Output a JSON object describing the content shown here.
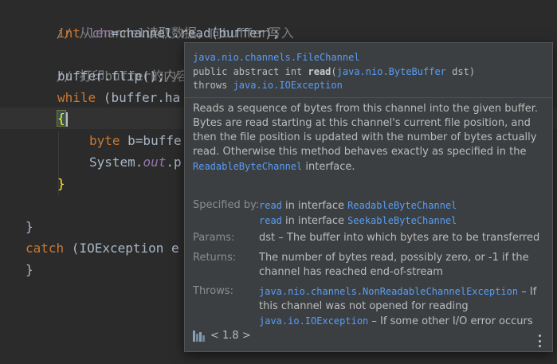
{
  "editor": {
    "line1": {
      "comment": "// 从channel读取数据，向buffer写入"
    },
    "line2": {
      "kw": "int",
      "var": "len",
      "rest": "=channel.read(buffer);"
    },
    "line3": {
      "comment": "// 打印buffer的内容"
    },
    "line4": {
      "code": "buffer.flip();",
      "comment": "//"
    },
    "line5": {
      "kw": "while",
      "code": " (buffer.ha"
    },
    "line6": {
      "brace": "{"
    },
    "line7": {
      "kw": "byte",
      "code": " b=buffe"
    },
    "line8": {
      "code_a": "System.",
      "field": "out",
      "code_b": ".p"
    },
    "line9": {
      "brace": "}"
    },
    "line10": {
      "brace": "}"
    },
    "line11": {
      "kw": "catch",
      "code": " (IOException e"
    },
    "line12": {
      "brace": "}"
    }
  },
  "popup": {
    "class_link": "java.nio.channels.FileChannel",
    "sig_prefix": "public abstract int ",
    "sig_method": "read",
    "sig_open": "(",
    "sig_param_type": "java.nio.ByteBuffer",
    "sig_param": " dst)",
    "throws_kw": "throws ",
    "throws_link": "java.io.IOException",
    "description_text": "Reads a sequence of bytes from this channel into the given buffer. Bytes are read starting at this channel's current file position, and then the file position is updated with the number of bytes actually read. Otherwise this method behaves exactly as specified in the ",
    "description_link": "ReadableByteChannel",
    "description_tail": " interface.",
    "specified_by": {
      "label": "Specified by:",
      "items": [
        {
          "method": "read",
          "middle": " in interface ",
          "iface": "ReadableByteChannel"
        },
        {
          "method": "read",
          "middle": " in interface ",
          "iface": "SeekableByteChannel"
        }
      ]
    },
    "params": {
      "label": "Params:",
      "text": "dst – The buffer into which bytes are to be transferred"
    },
    "returns": {
      "label": "Returns:",
      "text": "The number of bytes read, possibly zero, or -1 if the channel has reached end-of-stream"
    },
    "throws": {
      "label": "Throws:",
      "items": [
        {
          "exception": "java.nio.channels.NonReadableChannelException",
          "text": " – If this channel was not opened for reading"
        },
        {
          "exception": "java.io.IOException",
          "text": " – If some other I/O error occurs"
        }
      ]
    },
    "footer": {
      "icon": "library-icon",
      "version": "< 1.8 >"
    },
    "menu_icon": "more-vertical-icon"
  }
}
